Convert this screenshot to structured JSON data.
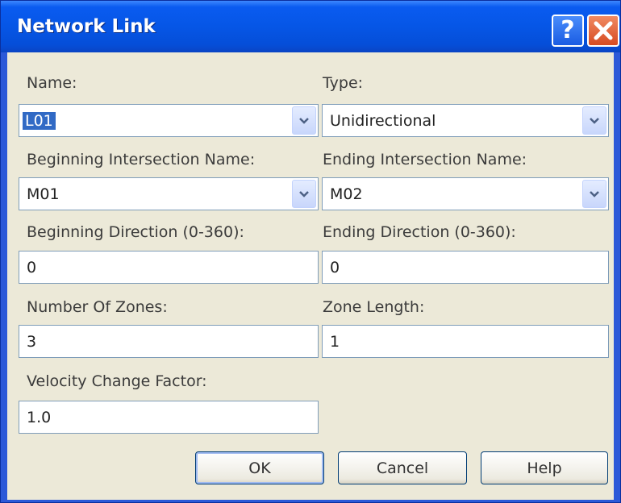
{
  "window": {
    "title": "Network Link",
    "help_icon": "question-icon",
    "close_icon": "close-icon"
  },
  "form": {
    "name": {
      "label": "Name:",
      "value": "L01"
    },
    "type": {
      "label": "Type:",
      "value": "Unidirectional"
    },
    "beginning_intersection": {
      "label": "Beginning Intersection Name:",
      "value": "M01"
    },
    "ending_intersection": {
      "label": "Ending Intersection Name:",
      "value": "M02"
    },
    "beginning_direction": {
      "label": "Beginning Direction (0-360):",
      "value": "0"
    },
    "ending_direction": {
      "label": "Ending Direction (0-360):",
      "value": "0"
    },
    "number_of_zones": {
      "label": "Number Of Zones:",
      "value": "3"
    },
    "zone_length": {
      "label": "Zone Length:",
      "value": "1"
    },
    "velocity_change_factor": {
      "label": "Velocity Change Factor:",
      "value": "1.0"
    }
  },
  "buttons": {
    "ok": "OK",
    "cancel": "Cancel",
    "help": "Help"
  },
  "colors": {
    "titlebar": "#0656e6",
    "client": "#ece9d8",
    "selection": "#316ac5",
    "field_border": "#7f9db9",
    "close": "#d74b22"
  }
}
